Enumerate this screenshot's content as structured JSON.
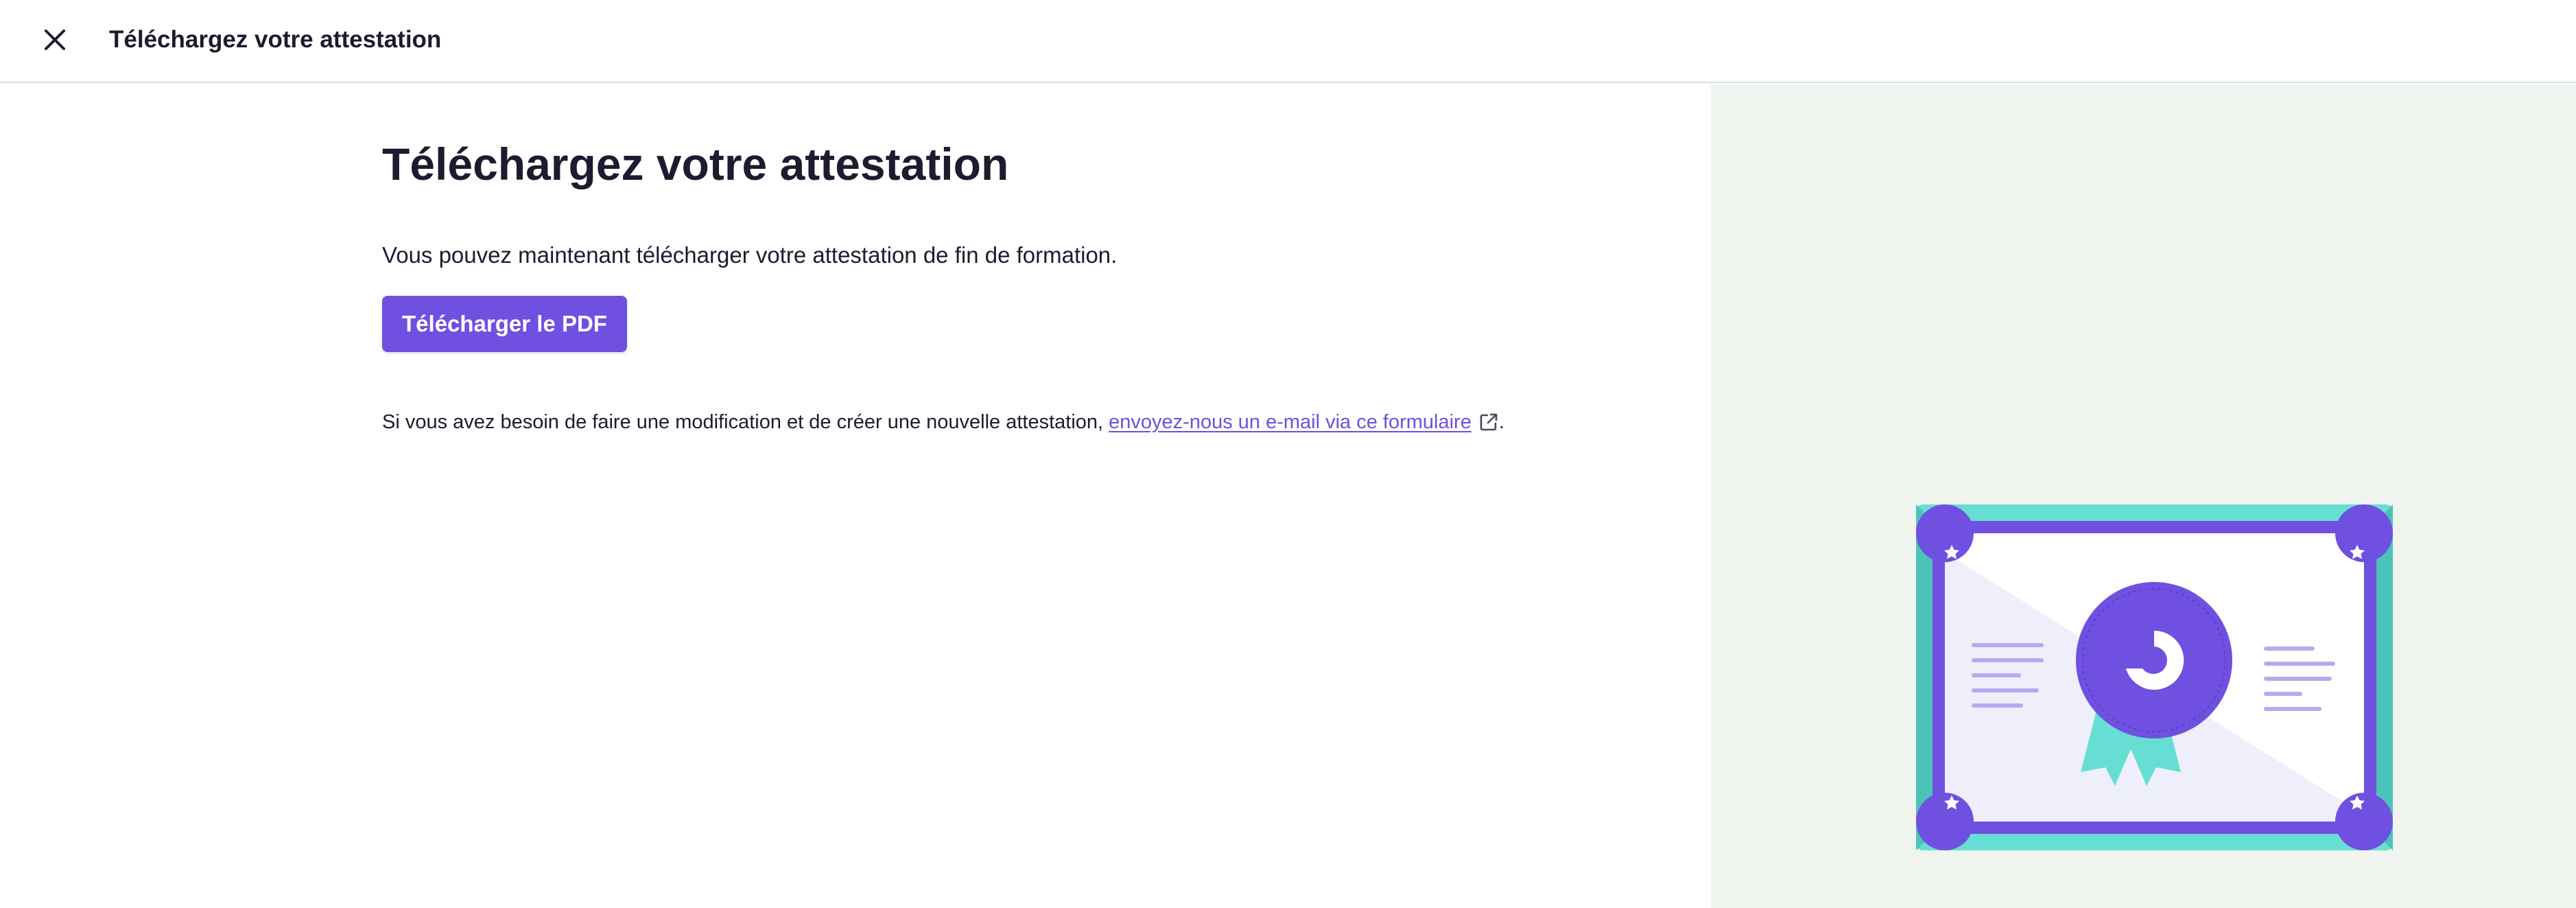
{
  "topbar": {
    "title": "Téléchargez votre attestation",
    "close_icon": "close-icon"
  },
  "main": {
    "heading": "Téléchargez votre attestation",
    "intro": "Vous pouvez maintenant télécharger votre attestation de fin de formation.",
    "download_button": "Télécharger le PDF",
    "note": {
      "prefix": "Si vous avez besoin de faire une modification et de créer une nouvelle attestation, ",
      "link_text": "envoyez-nous un e-mail via ce formulaire",
      "link_icon": "external-link-icon",
      "suffix": "."
    }
  },
  "illustration": {
    "name": "certificate-illustration"
  },
  "colors": {
    "accent": "#6f50e0",
    "text": "#1d1b2f",
    "panel_background": "#eff4ee",
    "frame_teal": "#67ded3",
    "divider": "#dcdce3"
  }
}
